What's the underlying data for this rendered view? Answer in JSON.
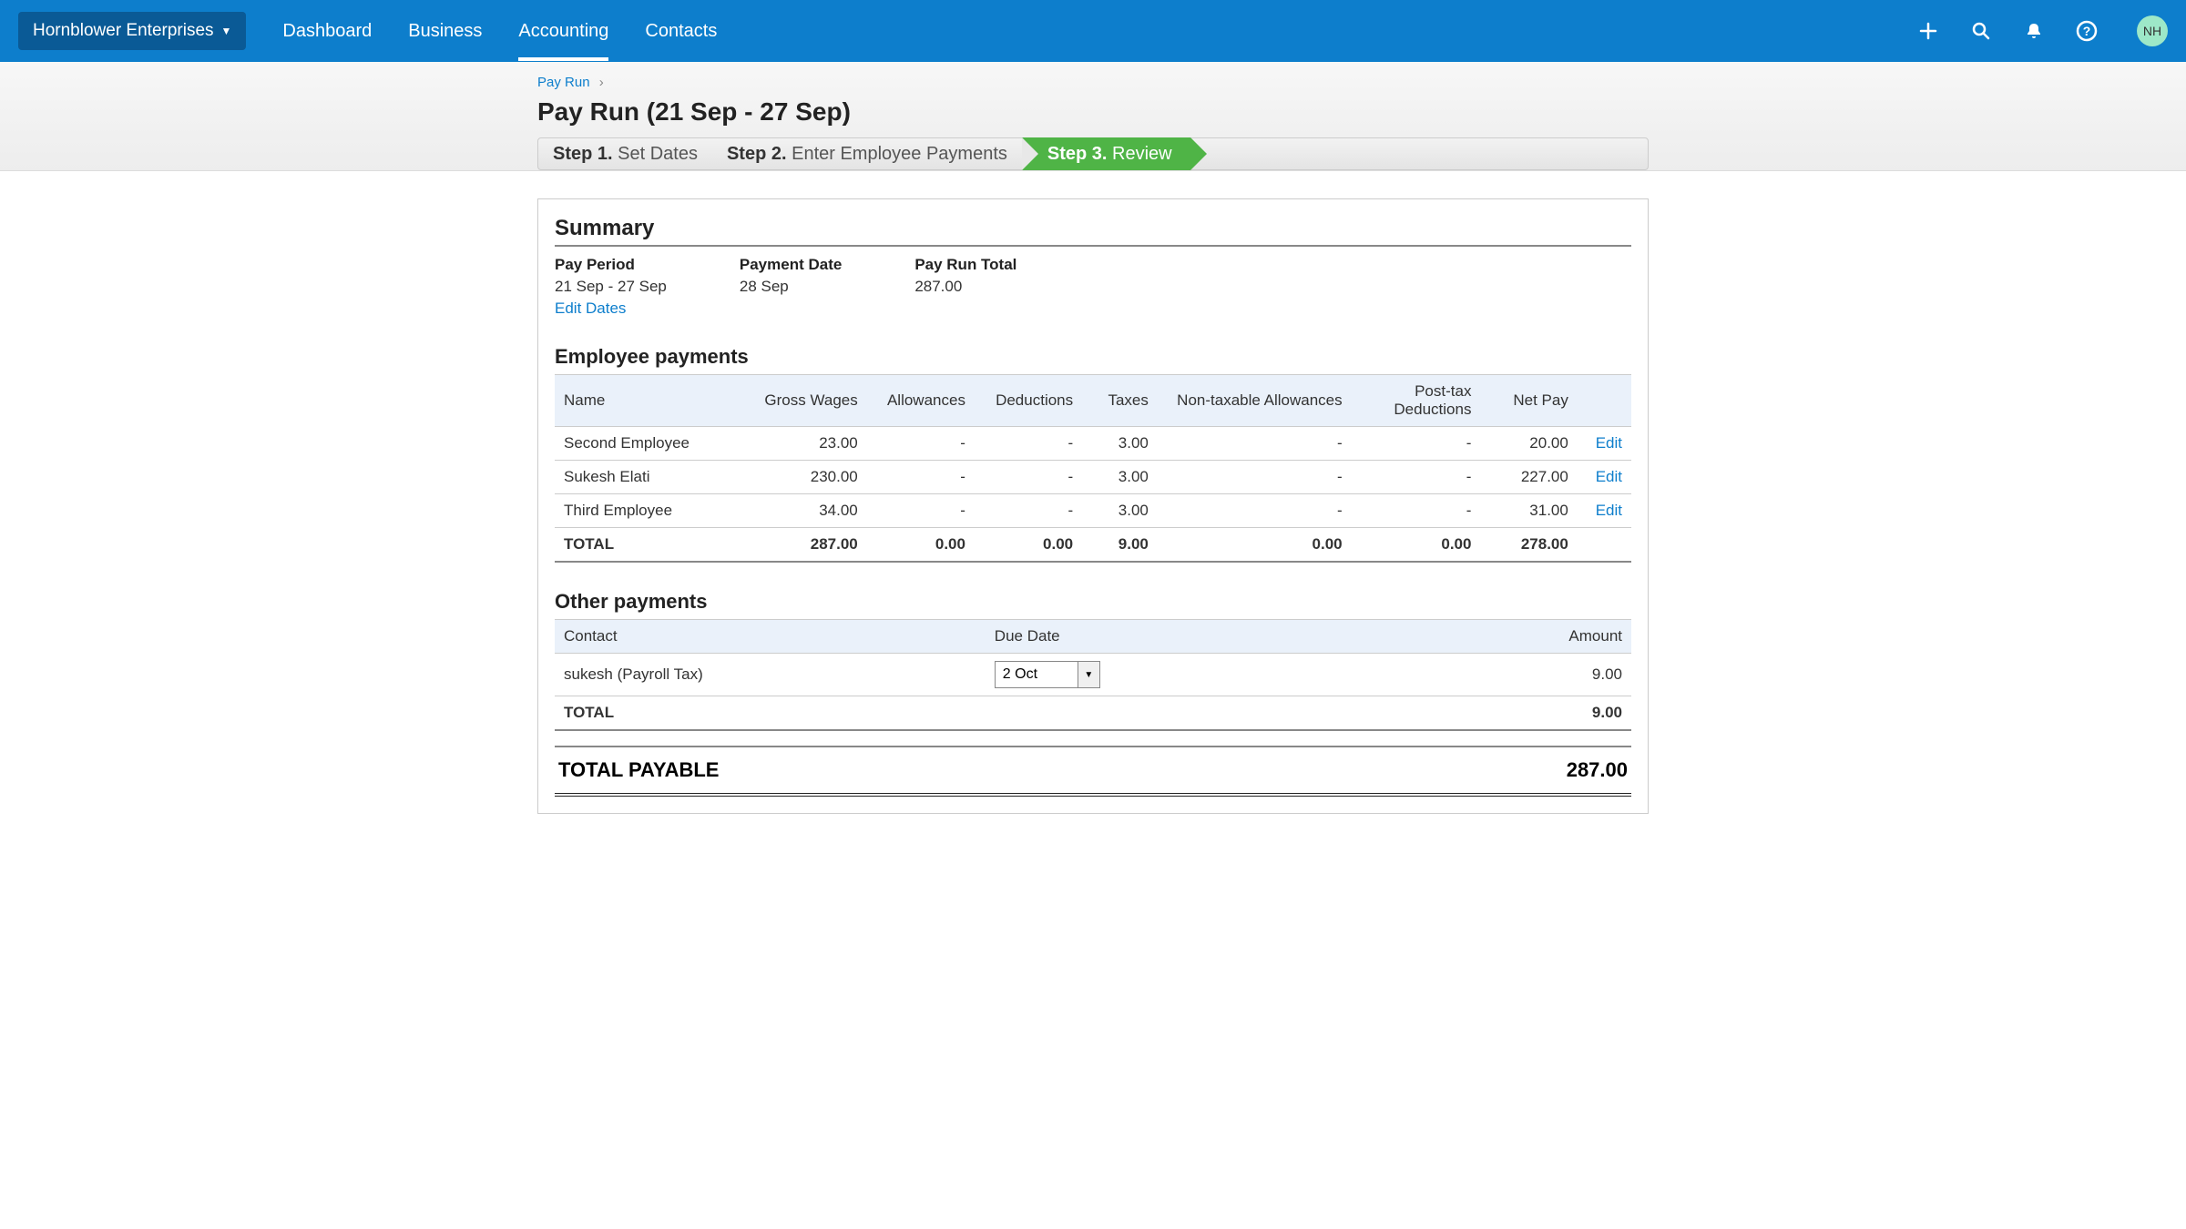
{
  "header": {
    "org_name": "Hornblower Enterprises",
    "nav": [
      "Dashboard",
      "Business",
      "Accounting",
      "Contacts"
    ],
    "active_nav_index": 2,
    "avatar_initials": "NH"
  },
  "breadcrumb": {
    "parent": "Pay Run"
  },
  "page_title": "Pay Run (21 Sep - 27 Sep)",
  "steps": [
    {
      "num": "Step 1.",
      "label": "Set Dates"
    },
    {
      "num": "Step 2.",
      "label": "Enter Employee Payments"
    },
    {
      "num": "Step 3.",
      "label": "Review"
    }
  ],
  "active_step_index": 2,
  "summary": {
    "title": "Summary",
    "pay_period_label": "Pay Period",
    "pay_period_value": "21 Sep - 27 Sep",
    "edit_dates_label": "Edit Dates",
    "payment_date_label": "Payment Date",
    "payment_date_value": "28 Sep",
    "pay_run_total_label": "Pay Run Total",
    "pay_run_total_value": "287.00"
  },
  "employee_payments": {
    "title": "Employee payments",
    "columns": [
      "Name",
      "Gross Wages",
      "Allowances",
      "Deductions",
      "Taxes",
      "Non-taxable Allowances",
      "Post-tax Deductions",
      "Net Pay"
    ],
    "rows": [
      {
        "name": "Second Employee",
        "gross": "23.00",
        "allow": "-",
        "deduct": "-",
        "taxes": "3.00",
        "nta": "-",
        "ptd": "-",
        "net": "20.00"
      },
      {
        "name": "Sukesh Elati",
        "gross": "230.00",
        "allow": "-",
        "deduct": "-",
        "taxes": "3.00",
        "nta": "-",
        "ptd": "-",
        "net": "227.00"
      },
      {
        "name": "Third Employee",
        "gross": "34.00",
        "allow": "-",
        "deduct": "-",
        "taxes": "3.00",
        "nta": "-",
        "ptd": "-",
        "net": "31.00"
      }
    ],
    "total_label": "TOTAL",
    "totals": {
      "gross": "287.00",
      "allow": "0.00",
      "deduct": "0.00",
      "taxes": "9.00",
      "nta": "0.00",
      "ptd": "0.00",
      "net": "278.00"
    },
    "edit_label": "Edit"
  },
  "other_payments": {
    "title": "Other payments",
    "columns": [
      "Contact",
      "Due Date",
      "Amount"
    ],
    "rows": [
      {
        "contact": "sukesh (Payroll Tax)",
        "due_date": "2 Oct",
        "amount": "9.00"
      }
    ],
    "total_label": "TOTAL",
    "total_amount": "9.00"
  },
  "total_payable": {
    "label": "TOTAL PAYABLE",
    "amount": "287.00"
  }
}
